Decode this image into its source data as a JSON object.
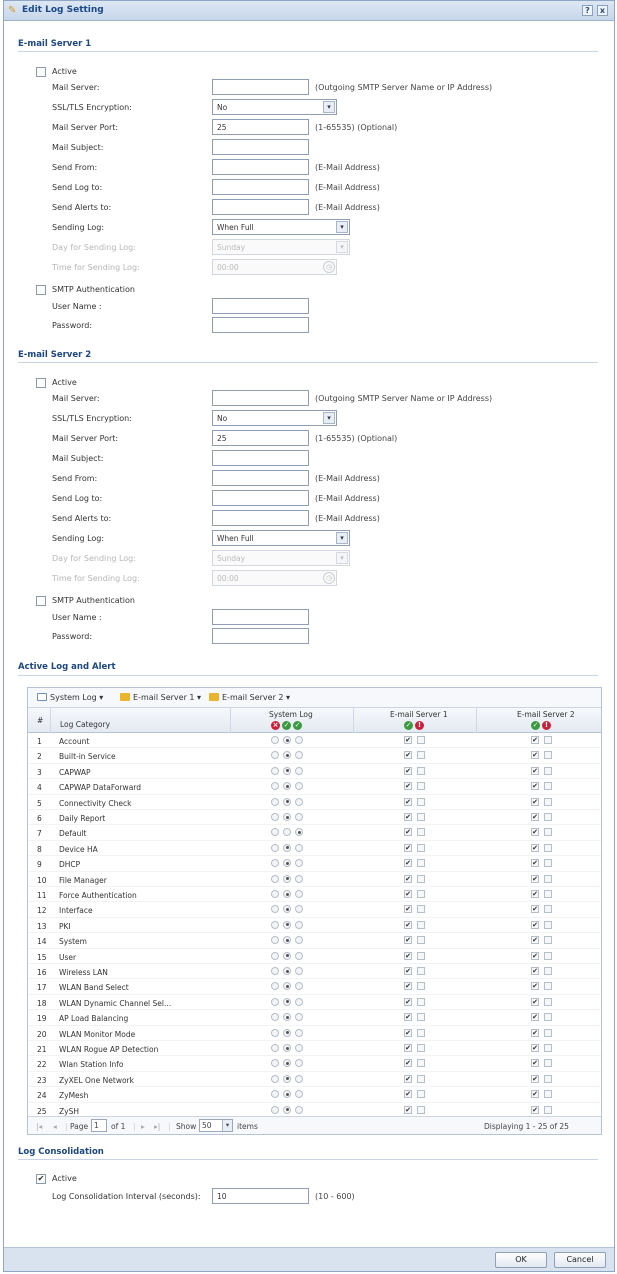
{
  "window": {
    "title": "Edit Log Setting",
    "help": "?",
    "close": "x"
  },
  "server1": {
    "title": "E-mail Server 1",
    "active_label": "Active",
    "mail_server_label": "Mail Server:",
    "mail_server_hint": "(Outgoing SMTP Server Name or IP Address)",
    "ssl_label": "SSL/TLS Encryption:",
    "ssl_value": "No",
    "port_label": "Mail Server Port:",
    "port_value": "25",
    "port_hint": "(1-65535) (Optional)",
    "subject_label": "Mail Subject:",
    "from_label": "Send From:",
    "from_hint": "(E-Mail Address)",
    "logto_label": "Send Log to:",
    "logto_hint": "(E-Mail Address)",
    "alerts_label": "Send Alerts to:",
    "alerts_hint": "(E-Mail Address)",
    "sending_label": "Sending Log:",
    "sending_value": "When Full",
    "day_label": "Day for Sending Log:",
    "day_value": "Sunday",
    "time_label": "Time for Sending Log:",
    "time_value": "00:00",
    "smtp_label": "SMTP Authentication",
    "user_label": "User Name :",
    "password_label": "Password:"
  },
  "server2": {
    "title": "E-mail Server 2",
    "active_label": "Active",
    "mail_server_label": "Mail Server:",
    "mail_server_hint": "(Outgoing SMTP Server Name or IP Address)",
    "ssl_label": "SSL/TLS Encryption:",
    "ssl_value": "No",
    "port_label": "Mail Server Port:",
    "port_value": "25",
    "port_hint": "(1-65535) (Optional)",
    "subject_label": "Mail Subject:",
    "from_label": "Send From:",
    "from_hint": "(E-Mail Address)",
    "logto_label": "Send Log to:",
    "logto_hint": "(E-Mail Address)",
    "alerts_label": "Send Alerts to:",
    "alerts_hint": "(E-Mail Address)",
    "sending_label": "Sending Log:",
    "sending_value": "When Full",
    "day_label": "Day for Sending Log:",
    "day_value": "Sunday",
    "time_label": "Time for Sending Log:",
    "time_value": "00:00",
    "smtp_label": "SMTP Authentication",
    "user_label": "User Name :",
    "password_label": "Password:"
  },
  "alert": {
    "title": "Active Log and Alert",
    "toolbar": {
      "system_log": "System Log",
      "server1": "E-mail Server 1",
      "server2": "E-mail Server 2"
    },
    "headers": {
      "num": "#",
      "category": "Log Category",
      "system_log": "System Log",
      "server1": "E-mail Server 1",
      "server2": "E-mail Server 2"
    },
    "rows": [
      {
        "n": "1",
        "name": "Account",
        "sys": 1
      },
      {
        "n": "2",
        "name": "Built-in Service",
        "sys": 1
      },
      {
        "n": "3",
        "name": "CAPWAP",
        "sys": 1
      },
      {
        "n": "4",
        "name": "CAPWAP DataForward",
        "sys": 1
      },
      {
        "n": "5",
        "name": "Connectivity Check",
        "sys": 1
      },
      {
        "n": "6",
        "name": "Daily Report",
        "sys": 1
      },
      {
        "n": "7",
        "name": "Default",
        "sys": 2
      },
      {
        "n": "8",
        "name": "Device HA",
        "sys": 1
      },
      {
        "n": "9",
        "name": "DHCP",
        "sys": 1
      },
      {
        "n": "10",
        "name": "File Manager",
        "sys": 1
      },
      {
        "n": "11",
        "name": "Force Authentication",
        "sys": 1
      },
      {
        "n": "12",
        "name": "Interface",
        "sys": 1
      },
      {
        "n": "13",
        "name": "PKI",
        "sys": 1
      },
      {
        "n": "14",
        "name": "System",
        "sys": 1
      },
      {
        "n": "15",
        "name": "User",
        "sys": 1
      },
      {
        "n": "16",
        "name": "Wireless LAN",
        "sys": 1
      },
      {
        "n": "17",
        "name": "WLAN Band Select",
        "sys": 1
      },
      {
        "n": "18",
        "name": "WLAN Dynamic Channel Sel...",
        "sys": 1
      },
      {
        "n": "19",
        "name": "AP Load Balancing",
        "sys": 1
      },
      {
        "n": "20",
        "name": "WLAN Monitor Mode",
        "sys": 1
      },
      {
        "n": "21",
        "name": "WLAN Rogue AP Detection",
        "sys": 1
      },
      {
        "n": "22",
        "name": "Wlan Station Info",
        "sys": 1
      },
      {
        "n": "23",
        "name": "ZyXEL One Network",
        "sys": 1
      },
      {
        "n": "24",
        "name": "ZyMesh",
        "sys": 1
      },
      {
        "n": "25",
        "name": "ZySH",
        "sys": 1
      }
    ],
    "footer": {
      "page_label": "Page",
      "page_value": "1",
      "of_label": "of 1",
      "show_label": "Show",
      "show_value": "50",
      "items_label": "items",
      "displaying": "Displaying 1 - 25 of 25"
    }
  },
  "consolidation": {
    "title": "Log Consolidation",
    "active_label": "Active",
    "interval_label": "Log Consolidation Interval (seconds):",
    "interval_value": "10",
    "interval_hint": "(10 - 600)"
  },
  "buttons": {
    "ok": "OK",
    "cancel": "Cancel"
  }
}
